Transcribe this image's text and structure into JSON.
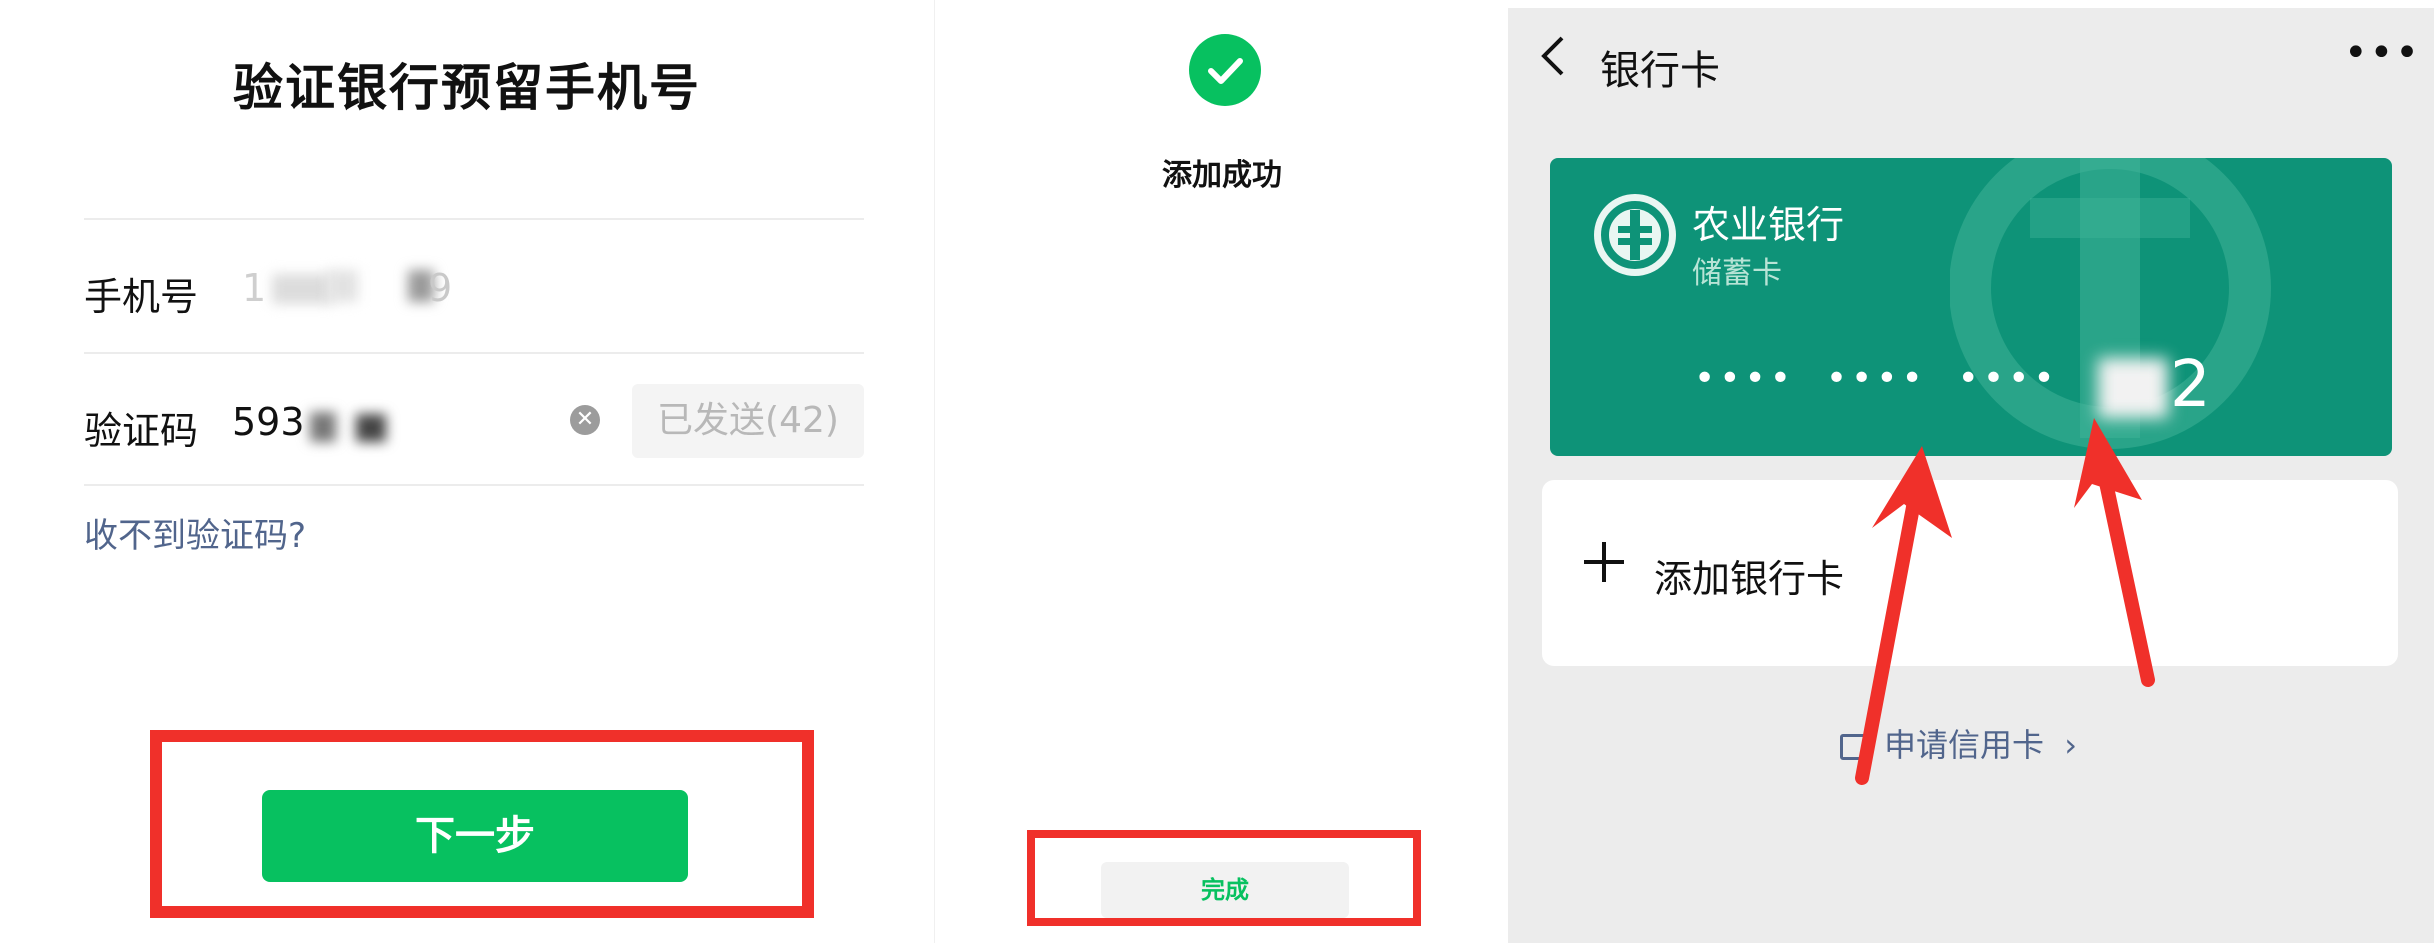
{
  "verify": {
    "title": "验证银行预留手机号",
    "phone_label": "手机号",
    "phone_value": "1",
    "phone_end": "9",
    "code_label": "验证码",
    "code_value": "593",
    "resend_label": "已发送(42)",
    "no_code_link": "收不到验证码?",
    "next_button": "下一步"
  },
  "success": {
    "message": "添加成功",
    "done_button": "完成"
  },
  "bankcard": {
    "nav_title": "银行卡",
    "back_icon": "chevron-left-icon",
    "more_icon": "more-dots-icon",
    "more_glyph": "•••",
    "card": {
      "bank_name": "农业银行",
      "card_type": "储蓄卡",
      "masked_number": "••••  ••••  ••••",
      "last_digit_visible": "2",
      "color": "#0e9378"
    },
    "add_card_label": "添加银行卡",
    "apply_credit_label": "申请信用卡",
    "apply_chevron": "›"
  },
  "colors": {
    "accent_green": "#07c160",
    "highlight_red": "#f0302a",
    "link_blue": "#51658c"
  }
}
